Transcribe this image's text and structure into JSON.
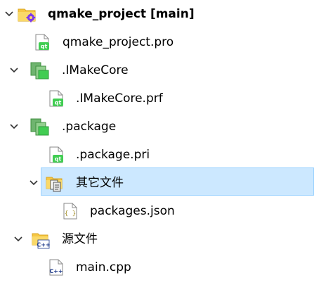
{
  "tree": {
    "items": [
      {
        "label": "qmake_project [main]",
        "icon": "qmake-project-folder-icon",
        "expanded": true
      },
      {
        "label": "qmake_project.pro",
        "icon": "qt-file-icon"
      },
      {
        "label": ".IMakeCore",
        "icon": "qt-folder-icon",
        "expanded": true
      },
      {
        "label": ".IMakeCore.prf",
        "icon": "qt-file-icon"
      },
      {
        "label": ".package",
        "icon": "qt-folder-icon",
        "expanded": true
      },
      {
        "label": ".package.pri",
        "icon": "qt-file-icon"
      },
      {
        "label": "其它文件",
        "icon": "other-files-folder-icon",
        "expanded": true,
        "selected": true
      },
      {
        "label": "packages.json",
        "icon": "json-file-icon"
      },
      {
        "label": "源文件",
        "icon": "cpp-folder-icon",
        "expanded": true
      },
      {
        "label": "main.cpp",
        "icon": "cpp-file-icon"
      }
    ]
  },
  "colors": {
    "selection_bg": "#cce8ff",
    "selection_border": "#99d1ff",
    "qt_green": "#41cd52",
    "folder_yellow": "#f6c744",
    "cpp_blue": "#1e3a8a"
  }
}
